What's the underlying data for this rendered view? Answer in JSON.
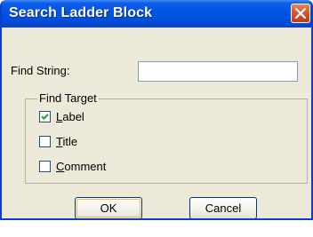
{
  "dialog": {
    "title": "Search Ladder Block",
    "close_icon": "close-icon",
    "accent_color": "#0054e3",
    "close_color": "#d6532a"
  },
  "find_string": {
    "label": "Find String:",
    "value": "",
    "placeholder": ""
  },
  "find_target": {
    "legend": "Find Target",
    "options": [
      {
        "label_before": "",
        "mnemonic": "L",
        "label_after": "abel",
        "checked": true
      },
      {
        "label_before": "",
        "mnemonic": "T",
        "label_after": "itle",
        "checked": false
      },
      {
        "label_before": "",
        "mnemonic": "C",
        "label_after": "omment",
        "checked": false
      }
    ]
  },
  "buttons": {
    "ok_label": "OK",
    "cancel_label": "Cancel"
  }
}
